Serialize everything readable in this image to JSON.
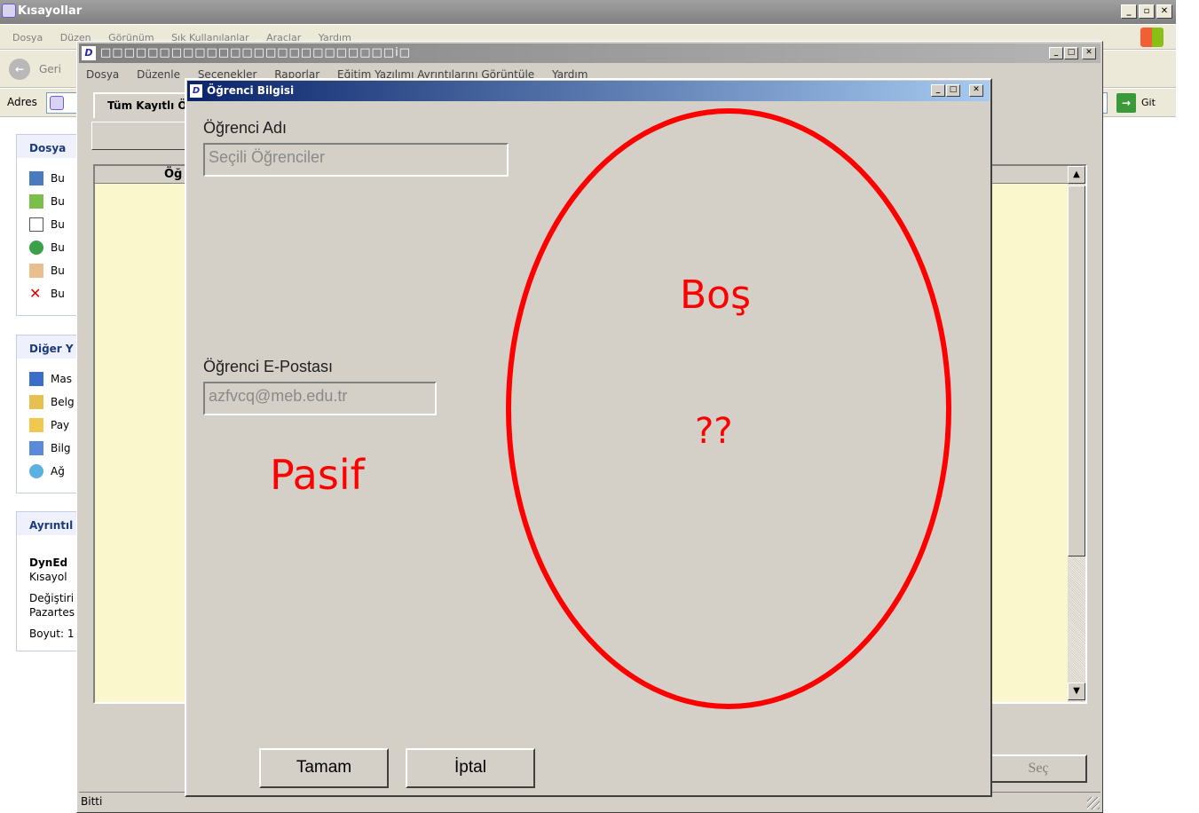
{
  "explorer": {
    "title": "Kısayollar",
    "menu": [
      "Dosya",
      "Düzen",
      "Görünüm",
      "Sık Kullanılanlar",
      "Araçlar",
      "Yardım"
    ],
    "back_label": "Geri",
    "address_label": "Adres",
    "go_label": "Git",
    "panels": {
      "file_tasks_title": "Dosya",
      "file_tasks": [
        "Bu",
        "Bu",
        "Bu",
        "Bu",
        "Bu",
        "Bu"
      ],
      "other_places_title": "Diğer Y",
      "other_places": [
        "Mas",
        "Belg",
        "Pay",
        "Bilg",
        "Ağ"
      ],
      "details_title": "Ayrıntıl",
      "details_name": "DynEd",
      "details_type": "Kısayol",
      "details_modified_label": "Değiştiri",
      "details_modified_value": "Pazartes",
      "details_size": "Boyut: 1"
    }
  },
  "app": {
    "title": "□□□□□□□□□□□□□□□□□□□□□□□□□i□",
    "menu": [
      "Dosya",
      "Düzenle",
      "Seçenekler",
      "Raporlar",
      "Eğitim Yazılımı Ayrıntılarını Görüntüle",
      "Yardım"
    ],
    "tab_label": "Tüm Kayıtlı Ö",
    "column_header": "Öğ",
    "select_button": "Seç",
    "status": "Bitti"
  },
  "dialog": {
    "title": "Öğrenci Bilgisi",
    "name_label": "Öğrenci Adı",
    "name_value": "Seçili Öğrenciler",
    "email_label": "Öğrenci E-Postası",
    "email_value": "azfvcq@meb.edu.tr",
    "ok_button": "Tamam",
    "cancel_button": "İptal"
  },
  "annotations": {
    "passive": "Pasif",
    "empty": "Boş",
    "question": "??",
    "color": "#ff0000"
  }
}
